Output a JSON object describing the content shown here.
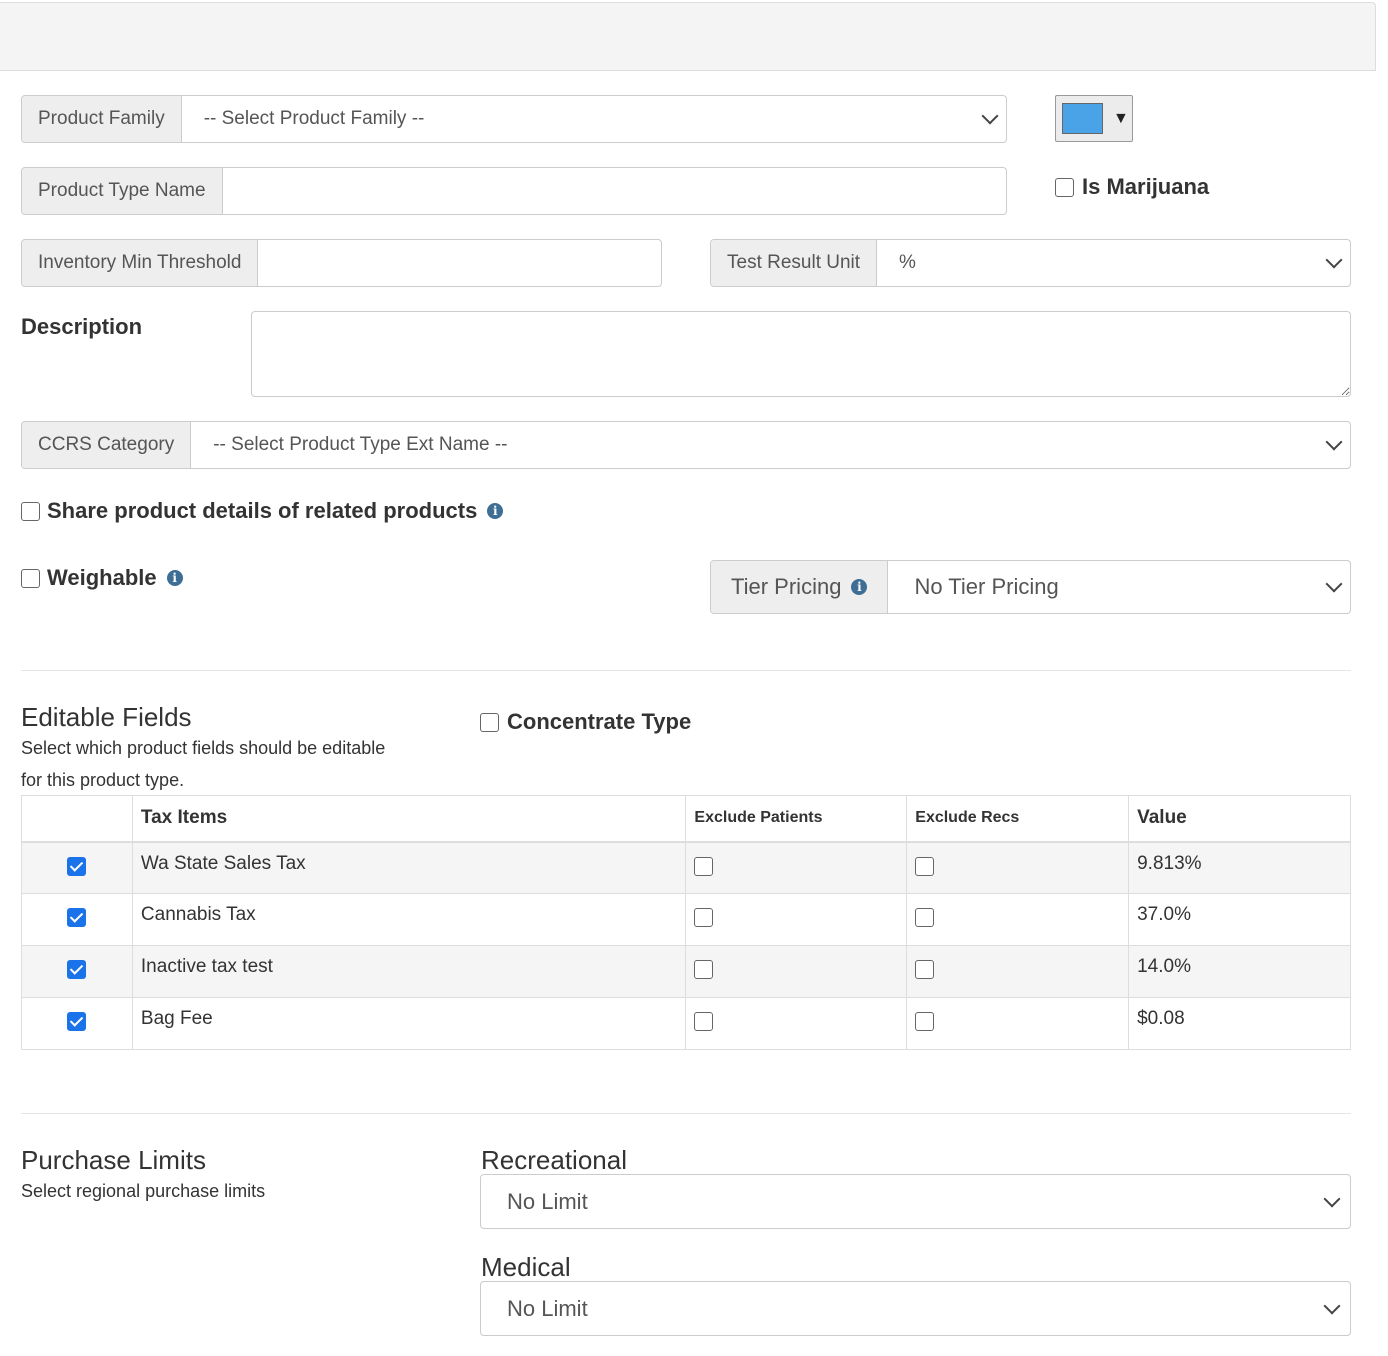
{
  "form": {
    "product_family": {
      "label": "Product Family",
      "value": "-- Select Product Family --"
    },
    "color_picker": {
      "color": "#4aa3e6",
      "caret": "▼"
    },
    "product_type_name": {
      "label": "Product Type Name",
      "value": ""
    },
    "is_marijuana": {
      "label": "Is Marijuana",
      "checked": false
    },
    "inventory_min_threshold": {
      "label": "Inventory Min Threshold",
      "value": ""
    },
    "test_result_unit": {
      "label": "Test Result Unit",
      "value": "%"
    },
    "description": {
      "label": "Description",
      "value": ""
    },
    "ccrs_category": {
      "label": "CCRS Category",
      "value": "-- Select Product Type Ext Name --"
    },
    "share_product_details": {
      "label": "Share product details of related products",
      "checked": false,
      "info_icon": "info-icon"
    },
    "weighable": {
      "label": "Weighable",
      "checked": false,
      "info_icon": "info-icon"
    },
    "tier_pricing": {
      "label": "Tier Pricing",
      "value": "No Tier Pricing",
      "info_icon": "info-icon"
    }
  },
  "editable_fields": {
    "title": "Editable Fields",
    "subtitle_line1": "Select which product fields should be editable",
    "subtitle_line2": "for this product type.",
    "concentrate_type": {
      "label": "Concentrate Type",
      "checked": false
    }
  },
  "tax_table": {
    "headers": [
      "",
      "Tax Items",
      "Exclude Patients",
      "Exclude Recs",
      "Value"
    ],
    "rows": [
      {
        "checked": true,
        "name": "Wa State Sales Tax",
        "exclude_patients": false,
        "exclude_recs": false,
        "value": "9.813%"
      },
      {
        "checked": true,
        "name": "Cannabis Tax",
        "exclude_patients": false,
        "exclude_recs": false,
        "value": "37.0%"
      },
      {
        "checked": true,
        "name": "Inactive tax test",
        "exclude_patients": false,
        "exclude_recs": false,
        "value": "14.0%"
      },
      {
        "checked": true,
        "name": "Bag Fee",
        "exclude_patients": false,
        "exclude_recs": false,
        "value": "$0.08"
      }
    ]
  },
  "purchase_limits": {
    "title": "Purchase Limits",
    "subtitle": "Select regional purchase limits",
    "recreational": {
      "label": "Recreational",
      "value": "No Limit"
    },
    "medical": {
      "label": "Medical",
      "value": "No Limit"
    }
  }
}
